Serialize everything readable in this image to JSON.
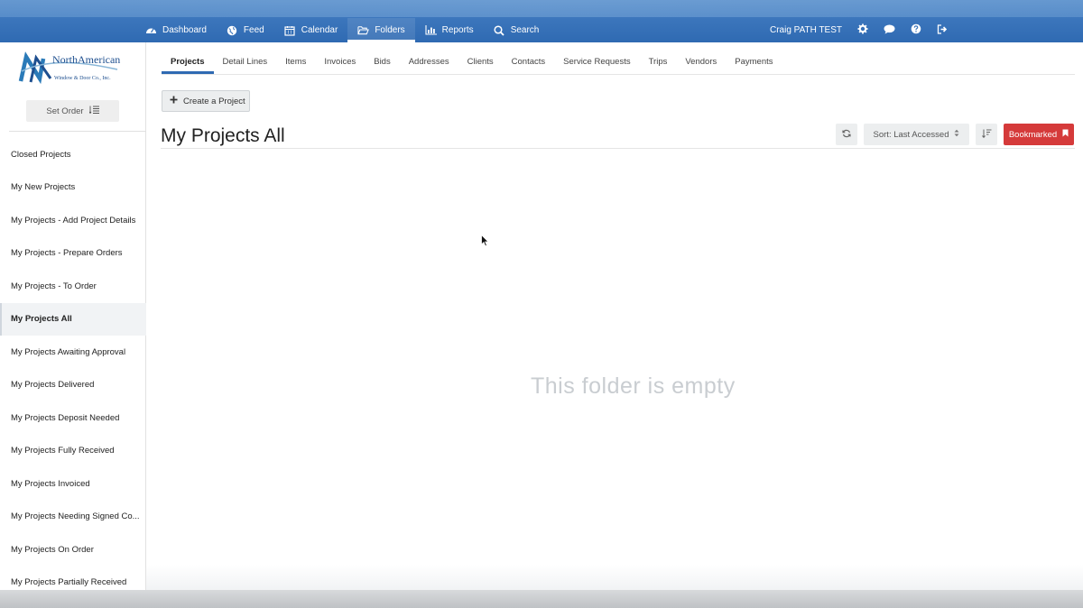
{
  "nav": {
    "items": [
      {
        "label": "Dashboard",
        "icon": "dashboard-icon"
      },
      {
        "label": "Feed",
        "icon": "globe-icon"
      },
      {
        "label": "Calendar",
        "icon": "calendar-icon"
      },
      {
        "label": "Folders",
        "icon": "folder-icon",
        "active": true
      },
      {
        "label": "Reports",
        "icon": "bar-chart-icon"
      },
      {
        "label": "Search",
        "icon": "search-icon"
      }
    ],
    "user_name": "Craig PATH TEST"
  },
  "sidebar": {
    "logo_text_top": "NorthAmerican",
    "logo_text_bottom": "Window & Door Co., Inc.",
    "set_order_label": "Set Order",
    "folders": [
      "Closed Projects",
      "My New Projects",
      "My Projects - Add Project Details",
      "My Projects - Prepare Orders",
      "My Projects - To Order",
      "My Projects All",
      "My Projects Awaiting Approval",
      "My Projects Delivered",
      "My Projects Deposit Needed",
      "My Projects Fully Received",
      "My Projects Invoiced",
      "My Projects Needing Signed Co...",
      "My Projects On Order",
      "My Projects Partially Received"
    ],
    "active_folder": "My Projects All"
  },
  "subtabs": [
    "Projects",
    "Detail Lines",
    "Items",
    "Invoices",
    "Bids",
    "Addresses",
    "Clients",
    "Contacts",
    "Service Requests",
    "Trips",
    "Vendors",
    "Payments"
  ],
  "main": {
    "create_label": "Create a Project",
    "title": "My Projects All",
    "sort_label": "Sort: Last Accessed",
    "bookmark_label": "Bookmarked",
    "empty_message": "This folder is empty"
  },
  "colors": {
    "accent": "#2f6ab2",
    "bookmark": "#d53a3a"
  }
}
